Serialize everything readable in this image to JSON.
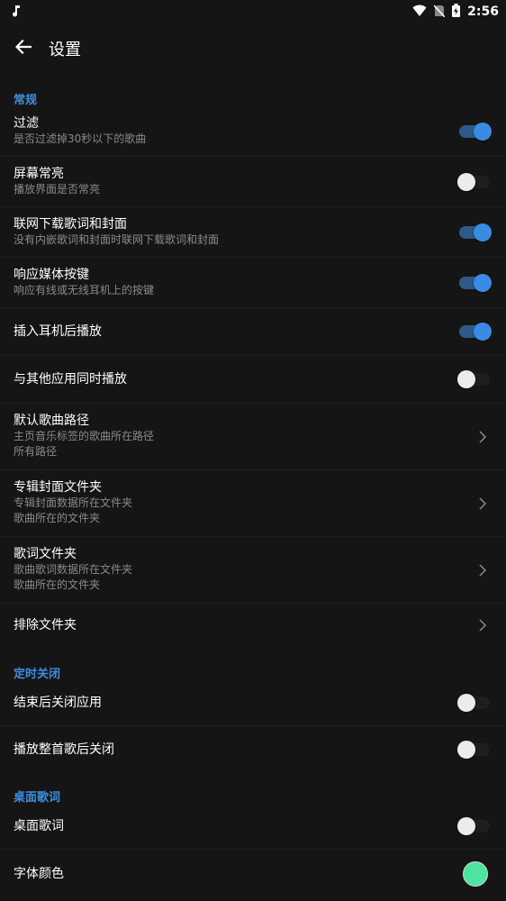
{
  "status_bar": {
    "time": "2:56"
  },
  "app_bar": {
    "title": "设置"
  },
  "sections": {
    "general": "常规",
    "timer": "定时关闭",
    "desktop_lyrics": "桌面歌词"
  },
  "settings": {
    "filter": {
      "title": "过滤",
      "subtitle": "是否过滤掉30秒以下的歌曲",
      "enabled": true
    },
    "screen_on": {
      "title": "屏幕常亮",
      "subtitle": "播放界面是否常亮",
      "enabled": false
    },
    "download_lyrics": {
      "title": "联网下载歌词和封面",
      "subtitle": "没有内嵌歌词和封面时联网下载歌词和封面",
      "enabled": true
    },
    "media_buttons": {
      "title": "响应媒体按键",
      "subtitle": "响应有线或无线耳机上的按键",
      "enabled": true
    },
    "headset_play": {
      "title": "插入耳机后播放",
      "enabled": true
    },
    "mix_play": {
      "title": "与其他应用同时播放",
      "enabled": false
    },
    "default_path": {
      "title": "默认歌曲路径",
      "subtitle": "主页音乐标签的歌曲所在路径",
      "value": "所有路径"
    },
    "cover_folder": {
      "title": "专辑封面文件夹",
      "subtitle": "专辑封面数据所在文件夹",
      "value": "歌曲所在的文件夹"
    },
    "lyrics_folder": {
      "title": "歌词文件夹",
      "subtitle": "歌曲歌词数据所在文件夹",
      "value": "歌曲所在的文件夹"
    },
    "exclude_folder": {
      "title": "排除文件夹"
    },
    "close_app_after": {
      "title": "结束后关闭应用",
      "enabled": false
    },
    "close_after_song": {
      "title": "播放整首歌后关闭",
      "enabled": false
    },
    "desktop_lyrics": {
      "title": "桌面歌词",
      "enabled": false
    },
    "font_color": {
      "title": "字体颜色",
      "color": "#4de4a0"
    }
  },
  "colors": {
    "accent": "#3a8be4",
    "section_header": "#3d8fe0",
    "background": "#151515"
  }
}
